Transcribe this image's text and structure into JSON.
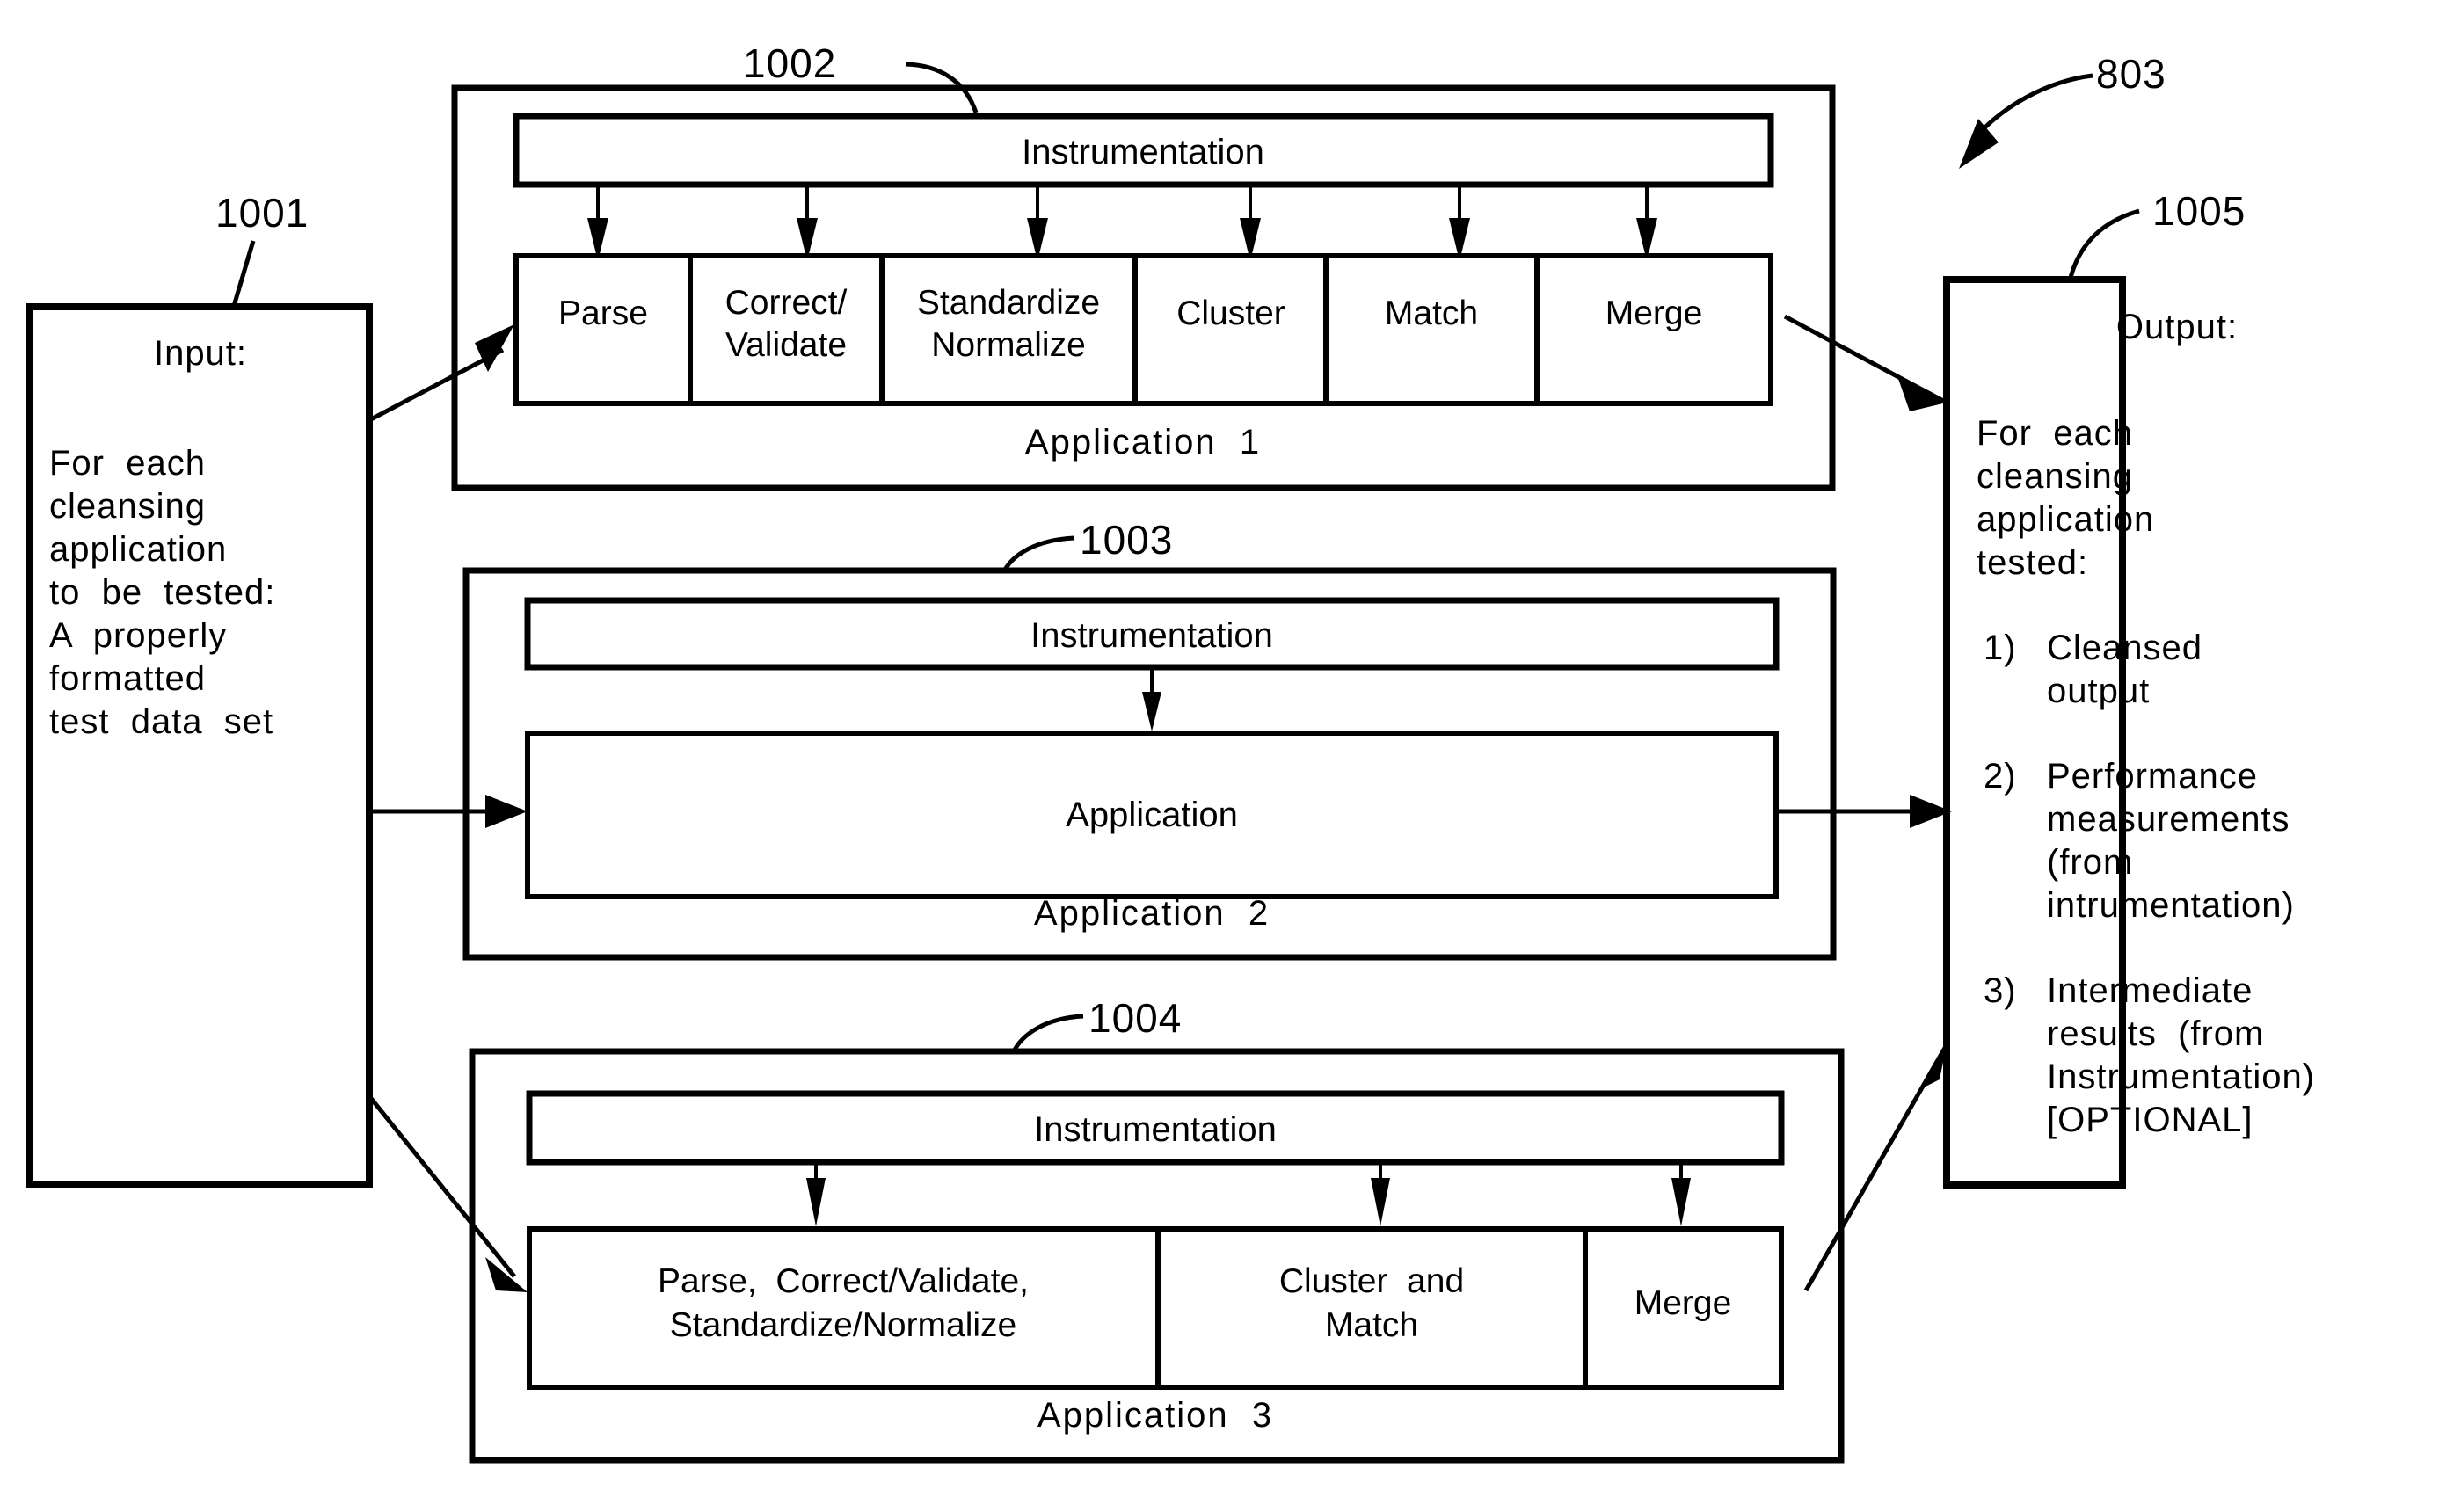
{
  "figure": {
    "reference_numbers": {
      "input_box": "1001",
      "application_1_box": "1002",
      "application_2_box": "1003",
      "application_3_box": "1004",
      "output_box": "1005",
      "figure_callout": "803"
    }
  },
  "input_box": {
    "title": "Input:",
    "lines": [
      "For  each",
      "cleansing",
      "application",
      "to  be  tested:",
      "A  properly",
      "formatted",
      "test  data  set"
    ]
  },
  "output_box": {
    "title": "Output:",
    "lines": [
      "For  each",
      "cleansing",
      "application",
      "tested:"
    ],
    "items": [
      {
        "marker": "1)",
        "lines": [
          "Cleansed",
          "output"
        ]
      },
      {
        "marker": "2)",
        "lines": [
          "Performance",
          "measurements",
          "(from",
          "intrumentation)"
        ]
      },
      {
        "marker": "3)",
        "lines": [
          "Intermediate",
          "results  (from",
          "Instrumentation)",
          "[OPTIONAL]"
        ]
      }
    ]
  },
  "application_1": {
    "instrumentation_label": "Instrumentation",
    "caption": "Application  1",
    "stages": [
      {
        "lines": [
          "Parse"
        ]
      },
      {
        "lines": [
          "Correct/",
          "Validate"
        ]
      },
      {
        "lines": [
          "Standardize",
          "Normalize"
        ]
      },
      {
        "lines": [
          "Cluster"
        ]
      },
      {
        "lines": [
          "Match"
        ]
      },
      {
        "lines": [
          "Merge"
        ]
      }
    ],
    "instrumentation_arrow_count": 6
  },
  "application_2": {
    "instrumentation_label": "Instrumentation",
    "caption": "Application  2",
    "stages": [
      {
        "lines": [
          "Application"
        ]
      }
    ],
    "instrumentation_arrow_count": 1
  },
  "application_3": {
    "instrumentation_label": "Instrumentation",
    "caption": "Application  3",
    "stages": [
      {
        "lines": [
          "Parse,  Correct/Validate,",
          "Standardize/Normalize"
        ]
      },
      {
        "lines": [
          "Cluster  and",
          "Match"
        ]
      },
      {
        "lines": [
          "Merge"
        ]
      }
    ],
    "instrumentation_arrow_count": 3
  },
  "colors": {
    "ink": "#000000",
    "paper": "#ffffff"
  }
}
